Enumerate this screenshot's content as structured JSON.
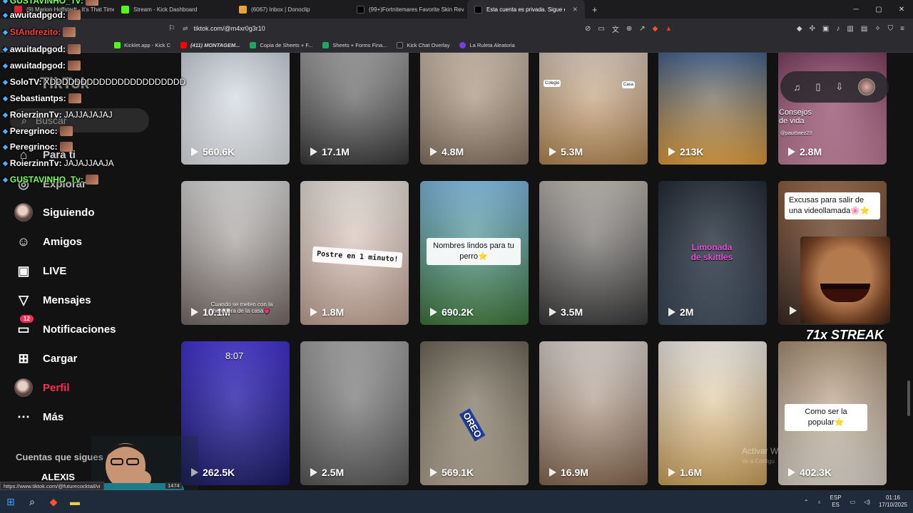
{
  "browser": {
    "tabs": [
      {
        "title": "(9) Marion Hoffstadt - It's That Time",
        "color": "#d23"
      },
      {
        "title": "Stream - Kick Dashboard",
        "color": "#53fc18"
      },
      {
        "title": "(6067) Inbox | Donoclip",
        "color": "#e8a33b"
      },
      {
        "title": "(99+)Fortnitemares Favorite Skin Rev",
        "color": "#000"
      },
      {
        "title": "Esta cuenta es privada. Sigue est",
        "color": "#000",
        "active": true
      }
    ],
    "url": "tiktok.com/@m4xr0g3r10",
    "status_url": "https://www.tiktok.com/@futurecocktail/vi",
    "status_suffix": "1474",
    "bookmarks": [
      {
        "label": "Kicklet.app - Kick C",
        "color": "#53fc18"
      },
      {
        "label": "(411) MONTAGEM...",
        "color": "#f00"
      },
      {
        "label": "Copia de Sheets + F...",
        "color": "#1fa463"
      },
      {
        "label": "Sheets + Forms Fina...",
        "color": "#1fa463"
      },
      {
        "label": "Kick Chat Overlay",
        "color": "#222"
      },
      {
        "label": "La Ruleta Aleatoria",
        "color": "#7a3fe0"
      }
    ]
  },
  "sidebar": {
    "search_placeholder": "Buscar",
    "items": [
      {
        "label": "Para ti",
        "icon": "home-icon"
      },
      {
        "label": "Explorar",
        "icon": "compass-icon"
      },
      {
        "label": "Siguiendo",
        "icon": "following-avatar"
      },
      {
        "label": "Amigos",
        "icon": "friends-icon"
      },
      {
        "label": "LIVE",
        "icon": "live-icon"
      },
      {
        "label": "Mensajes",
        "icon": "send-icon"
      },
      {
        "label": "Notificaciones",
        "icon": "inbox-icon",
        "badge": "12"
      },
      {
        "label": "Cargar",
        "icon": "plus-icon"
      },
      {
        "label": "Perfil",
        "icon": "profile-avatar"
      },
      {
        "label": "Más",
        "icon": "more-icon"
      }
    ],
    "following_header": "Cuentas que sigues",
    "following_first": "ALEXIS"
  },
  "videos": [
    {
      "views": "560.6K",
      "bg": "linear-gradient(180deg,#cfd6df,#e9ecef)"
    },
    {
      "views": "17.1M",
      "bg": "linear-gradient(180deg,#9a9a9a,#3a3a3a)"
    },
    {
      "views": "4.8M",
      "bg": "linear-gradient(180deg,#cbb9a7,#8a7765)"
    },
    {
      "views": "5.3M",
      "bg": "linear-gradient(180deg,#d8c7b8,#b98a52)"
    },
    {
      "views": "213K",
      "bg": "linear-gradient(180deg,#3d5e8a,#e8a23b)"
    },
    {
      "views": "2.8M",
      "bg": "linear-gradient(180deg,#7b3a5a,#c7839e)"
    },
    {
      "views": "10.1M",
      "bg": "linear-gradient(180deg,#d6d6d6,#7a6f6a)"
    },
    {
      "views": "1.8M",
      "bg": "linear-gradient(180deg,#e9e3dc,#c9a89a)"
    },
    {
      "views": "690.2K",
      "bg": "linear-gradient(180deg,#79b7e0,#3f7a3a)"
    },
    {
      "views": "3.5M",
      "bg": "linear-gradient(180deg,#b7b2ad,#3a3a3a)"
    },
    {
      "views": "2M",
      "bg": "linear-gradient(180deg,#1b2430,#3c4a5a)"
    },
    {
      "views": "",
      "bg": "linear-gradient(180deg,#8a5a3a,#3a2a22)"
    },
    {
      "views": "262.5K",
      "bg": "linear-gradient(180deg,#3a2bd0,#1a1a6a)"
    },
    {
      "views": "2.5M",
      "bg": "linear-gradient(180deg,#a0a0a0,#5a5a5a)"
    },
    {
      "views": "569.1K",
      "bg": "linear-gradient(180deg,#6b6455,#b7a995)"
    },
    {
      "views": "16.9M",
      "bg": "linear-gradient(180deg,#d9d2cc,#8a6a50)"
    },
    {
      "views": "1.6M",
      "bg": "linear-gradient(180deg,#f1ede8,#d5a95e)"
    },
    {
      "views": "402.3K",
      "bg": "linear-gradient(180deg,#a78c6e,#e4dcd2)"
    }
  ],
  "captions": {
    "v2_colegio": "Colegio",
    "v2_casa": "Casa",
    "v5_consejos": "Consejos de vida",
    "v5_user": "@paurbaez23",
    "v6_text": "Cuando se meten con la heredera de la casa💗",
    "v7_text": "Postre en 1 minuto!",
    "v8_text": "Nombres lindos para tu perro⭐",
    "v10_text": "Limonada de skittles",
    "v11_text": "Excusas para  salir de una videollamada🌸⭐",
    "v12_time": "8:07",
    "v17_text": "Como ser la popular⭐",
    "oreo": "OREO"
  },
  "overlay": {
    "chat": [
      {
        "user": "GUSTAVINHO_Tv:",
        "msg": ""
      },
      {
        "user": "awuitadpgod:",
        "msg": ""
      },
      {
        "user": "StAndrezito:",
        "msg": ""
      },
      {
        "user": "awuitadpgod:",
        "msg": ""
      },
      {
        "user": "awuitadpgod:",
        "msg": ""
      },
      {
        "user": "SoloTV:",
        "msg": "XDDDDDDDDDDDDDDDDDDDDDD"
      },
      {
        "user": "Sebastiantps:",
        "msg": ""
      },
      {
        "user": "RoierzinnTv:",
        "msg": "JAJJAJAJAJ"
      },
      {
        "user": "Peregrinoc:",
        "msg": ""
      },
      {
        "user": "Peregrinoc:",
        "msg": ""
      },
      {
        "user": "RoierzinnTv:",
        "msg": "JAJAJJAAJA"
      },
      {
        "user": "GUSTAVINHO_Tv:",
        "msg": ""
      }
    ],
    "streak": "71x STREAK",
    "watermark": "Activar W",
    "watermark_sub": "Ve a Configu"
  },
  "taskbar": {
    "lang_top": "ESP",
    "lang_bottom": "ES",
    "time": "01:16",
    "date": "17/10/2025"
  }
}
